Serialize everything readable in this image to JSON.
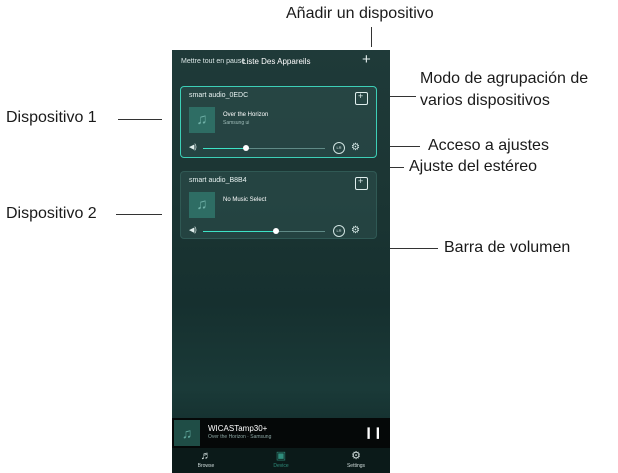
{
  "callouts": {
    "add_device": "Añadir un dispositivo",
    "group_mode_line1": "Modo de agrupación de",
    "group_mode_line2": "varios dispositivos",
    "device1": "Dispositivo 1",
    "settings_access": "Acceso a ajustes",
    "stereo_adjust": "Ajuste del estéreo",
    "device2": "Dispositivo 2",
    "volume_bar": "Barra de volumen"
  },
  "app": {
    "pause_all": "Mettre tout en pause",
    "list_title": "Liste Des Appareils",
    "add_icon": "plus-icon"
  },
  "devices": [
    {
      "name": "smart audio_0EDC",
      "song": "Over the Horizon",
      "artist": "Samsung ui",
      "volume": 0.35,
      "stereo_label": "LR",
      "icon": "music-note-icon"
    },
    {
      "name": "smart audio_B8B4",
      "song": "No Music Select",
      "artist": "",
      "volume": 0.6,
      "stereo_label": "LR",
      "icon": "music-note-icon"
    }
  ],
  "now_playing": {
    "title": "WICASTamp30+",
    "subtitle": "Over the Horizon · Samsung",
    "control_icon": "pause-icon"
  },
  "tabs": [
    {
      "label": "Browse",
      "icon": "music-note-icon",
      "active": false
    },
    {
      "label": "Device",
      "icon": "device-icon",
      "active": true
    },
    {
      "label": "Settings",
      "icon": "gear-icon",
      "active": false
    }
  ],
  "colors": {
    "accent": "#3de3c6",
    "active_tab": "#2f8d7c",
    "card_border_selected": "#3dcfb7"
  }
}
